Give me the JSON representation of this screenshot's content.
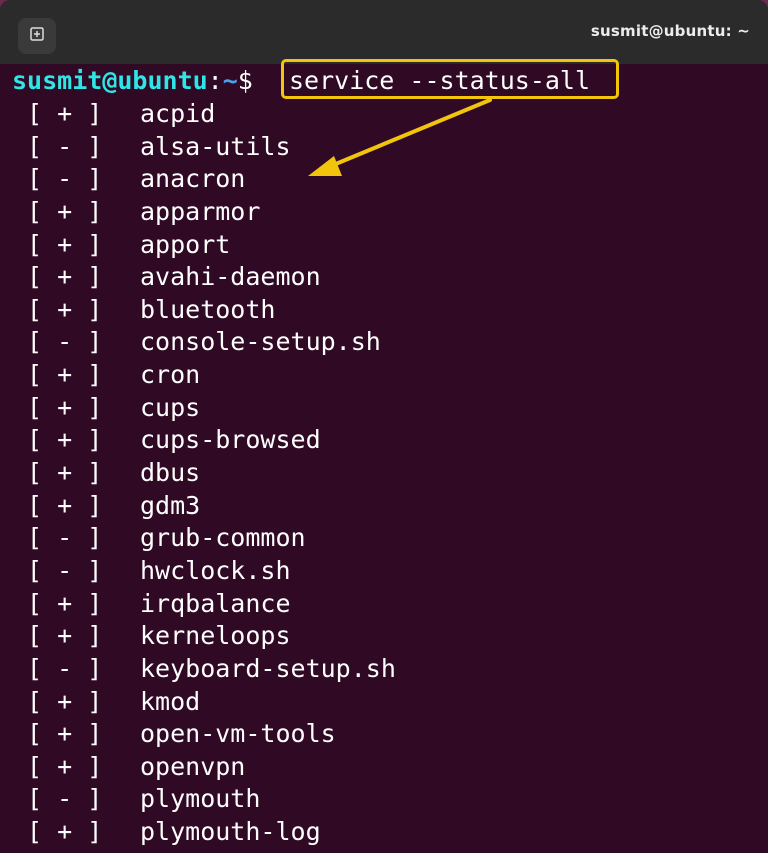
{
  "window": {
    "title": "susmit@ubuntu: ~"
  },
  "titlebar": {
    "new_tab_icon": "new-tab-icon"
  },
  "prompt": {
    "user_host": "susmit@ubuntu",
    "separator": ":",
    "path": "~",
    "symbol": "$ ",
    "command": "service --status-all"
  },
  "annotation": {
    "highlight_color": "#f2c40c",
    "arrow_color": "#f2c40c"
  },
  "services": [
    {
      "status": " [ + ]  ",
      "name": "acpid"
    },
    {
      "status": " [ - ]  ",
      "name": "alsa-utils"
    },
    {
      "status": " [ - ]  ",
      "name": "anacron"
    },
    {
      "status": " [ + ]  ",
      "name": "apparmor"
    },
    {
      "status": " [ + ]  ",
      "name": "apport"
    },
    {
      "status": " [ + ]  ",
      "name": "avahi-daemon"
    },
    {
      "status": " [ + ]  ",
      "name": "bluetooth"
    },
    {
      "status": " [ - ]  ",
      "name": "console-setup.sh"
    },
    {
      "status": " [ + ]  ",
      "name": "cron"
    },
    {
      "status": " [ + ]  ",
      "name": "cups"
    },
    {
      "status": " [ + ]  ",
      "name": "cups-browsed"
    },
    {
      "status": " [ + ]  ",
      "name": "dbus"
    },
    {
      "status": " [ + ]  ",
      "name": "gdm3"
    },
    {
      "status": " [ - ]  ",
      "name": "grub-common"
    },
    {
      "status": " [ - ]  ",
      "name": "hwclock.sh"
    },
    {
      "status": " [ + ]  ",
      "name": "irqbalance"
    },
    {
      "status": " [ + ]  ",
      "name": "kerneloops"
    },
    {
      "status": " [ - ]  ",
      "name": "keyboard-setup.sh"
    },
    {
      "status": " [ + ]  ",
      "name": "kmod"
    },
    {
      "status": " [ + ]  ",
      "name": "open-vm-tools"
    },
    {
      "status": " [ + ]  ",
      "name": "openvpn"
    },
    {
      "status": " [ - ]  ",
      "name": "plymouth"
    },
    {
      "status": " [ + ]  ",
      "name": "plymouth-log"
    }
  ]
}
